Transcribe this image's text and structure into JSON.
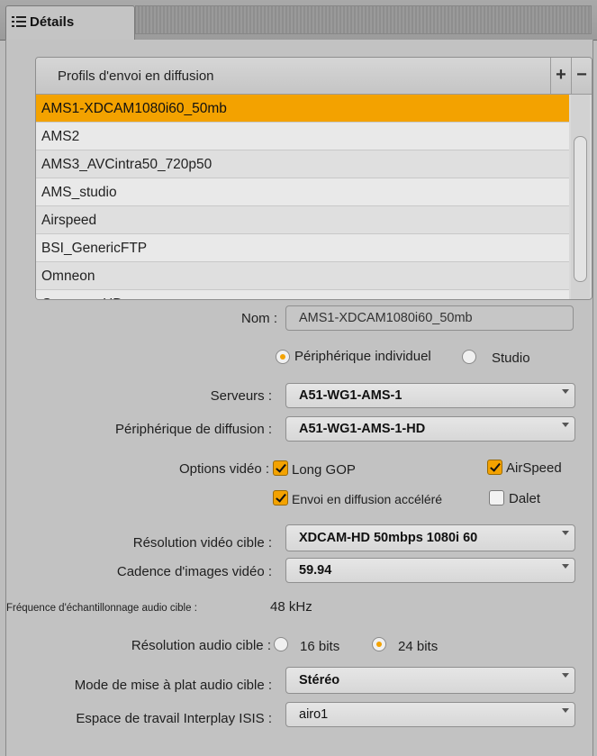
{
  "tab": {
    "label": "Détails",
    "icon": "list-icon"
  },
  "profiles": {
    "header": "Profils d'envoi en diffusion",
    "add_label": "+",
    "remove_label": "−",
    "items": [
      "AMS1-XDCAM1080i60_50mb",
      "AMS2",
      "AMS3_AVCintra50_720p50",
      "AMS_studio",
      "Airspeed",
      "BSI_GenericFTP",
      "Omneon",
      "Omneon_HD"
    ],
    "selected_index": 0
  },
  "form": {
    "name_label": "Nom :",
    "name_value": "AMS1-XDCAM1080i60_50mb",
    "device_type": {
      "option1": "Périphérique individuel",
      "option2": "Studio",
      "selected": "option1"
    },
    "servers_label": "Serveurs :",
    "servers_value": "A51-WG1-AMS-1",
    "playback_device_label": "Périphérique de diffusion :",
    "playback_device_value": "A51-WG1-AMS-1-HD",
    "video_options_label": "Options vidéo :",
    "long_gop_label": "Long GOP",
    "long_gop_checked": true,
    "airspeed_label": "AirSpeed",
    "airspeed_checked": true,
    "accelerated_label": "Envoi en diffusion accéléré",
    "accelerated_checked": true,
    "dalet_label": "Dalet",
    "dalet_checked": false,
    "target_video_res_label": "Résolution vidéo cible :",
    "target_video_res_value": "XDCAM-HD 50mbps 1080i 60",
    "frame_rate_label": "Cadence d'images vidéo :",
    "frame_rate_value": "59.94",
    "sample_rate_label": "Fréquence d'échantillonnage audio cible :",
    "sample_rate_value": "48",
    "sample_rate_unit": "kHz",
    "audio_res_label": "Résolution audio cible :",
    "audio_res_16": "16 bits",
    "audio_res_24": "24 bits",
    "audio_res_selected": "24 bits",
    "mixdown_label": "Mode de mise à plat audio cible :",
    "mixdown_value": "Stéréo",
    "workspace_label": "Espace de travail Interplay ISIS :",
    "workspace_value": "airo1"
  },
  "colors": {
    "accent": "#f3a200",
    "panel": "#c2c2c2"
  }
}
